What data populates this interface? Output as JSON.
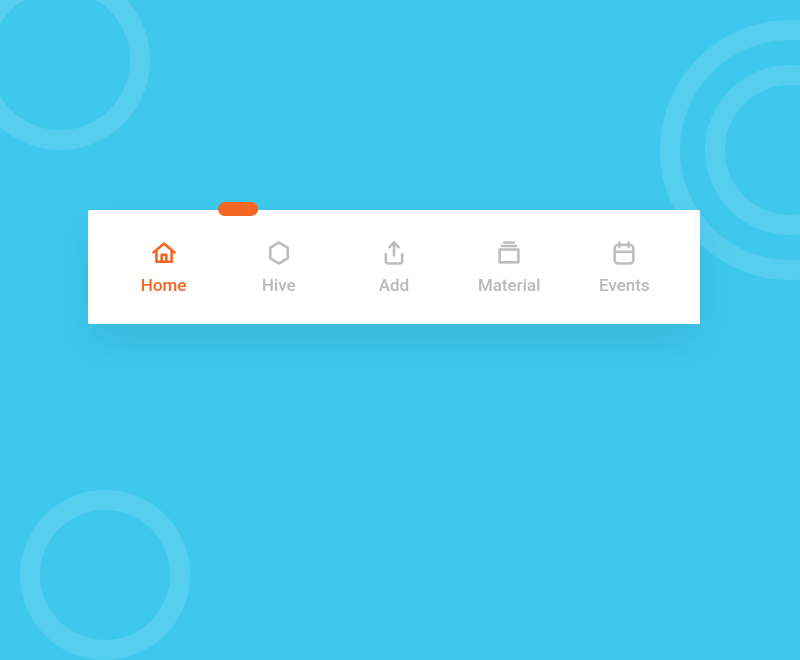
{
  "colors": {
    "accent": "#f26522",
    "inactive": "#b9b9b9",
    "bg": "#3ec8ed"
  },
  "tabs": [
    {
      "label": "Home",
      "icon": "home-icon",
      "active": true
    },
    {
      "label": "Hive",
      "icon": "hexagon-icon",
      "active": false
    },
    {
      "label": "Add",
      "icon": "share-up-icon",
      "active": false
    },
    {
      "label": "Material",
      "icon": "archive-icon",
      "active": false
    },
    {
      "label": "Events",
      "icon": "calendar-icon",
      "active": false
    }
  ]
}
